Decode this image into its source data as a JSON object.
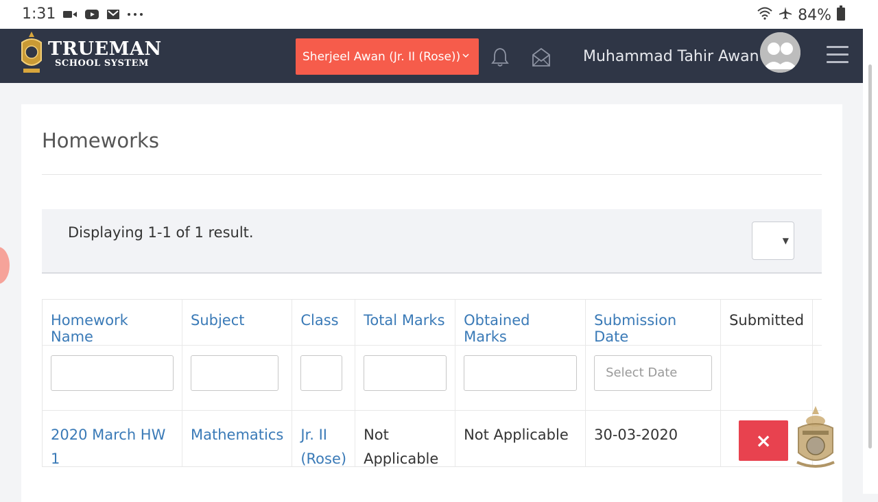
{
  "status_bar": {
    "time": "1:31",
    "battery": "84%",
    "icons": [
      "video-icon",
      "youtube-icon",
      "gmail-icon",
      "more-dots-icon",
      "wifi-icon",
      "airplane-icon",
      "battery-icon"
    ]
  },
  "header": {
    "logo_title": "TRUEMAN",
    "logo_subtitle": "SCHOOL SYSTEM",
    "student_selector": "Sherjeel Awan (Jr. II (Rose))",
    "user_name": "Muhammad Tahir Awan",
    "icons": [
      "bell-icon",
      "envelope-icon",
      "avatar",
      "hamburger-menu-icon"
    ]
  },
  "page": {
    "title": "Homeworks",
    "summary": "Displaying 1-1 of 1 result."
  },
  "table": {
    "columns": [
      "Homework Name",
      "Subject",
      "Class",
      "Total Marks",
      "Obtained Marks",
      "Submission Date",
      "Submitted"
    ],
    "date_placeholder": "Select Date",
    "rows": [
      {
        "homework_name": "2020 March HW 1",
        "subject": "Mathematics",
        "class_line1": "Jr. II",
        "class_line2": "(Rose)",
        "total_marks_line1": "Not",
        "total_marks_line2": "Applicable",
        "obtained_marks": "Not Applicable",
        "submission_date": "30-03-2020",
        "submitted_symbol": "×"
      }
    ]
  },
  "colors": {
    "nav_bg": "#2f3646",
    "student_button": "#f65c4b",
    "link": "#3a7ab7",
    "not_submitted_button": "#e8424f"
  }
}
